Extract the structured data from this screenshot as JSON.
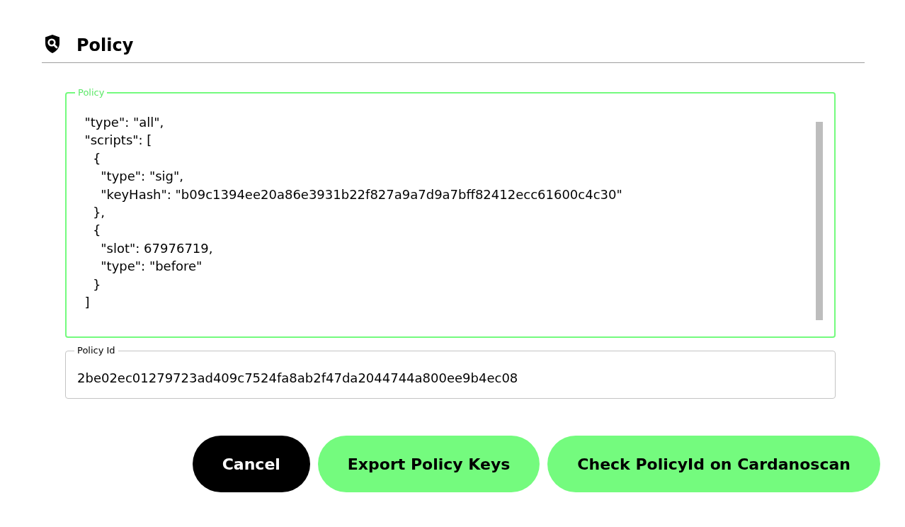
{
  "header": {
    "title": "Policy"
  },
  "policy_field": {
    "label": "Policy",
    "focused": true,
    "lines": [
      "  \"type\": \"all\",",
      "  \"scripts\": [",
      "    {",
      "      \"type\": \"sig\",",
      "      \"keyHash\": \"b09c1394ee20a86e3931b22f827a9a7d9a7bff82412ecc61600c4c30\"",
      "    },",
      "    {",
      "      \"slot\": 67976719,",
      "      \"type\": \"before\"",
      "    }",
      "  ]"
    ]
  },
  "policy_id_field": {
    "label": "Policy Id",
    "value": "2be02ec01279723ad409c7524fa8ab2f47da2044744a800ee9b4ec08"
  },
  "buttons": [
    {
      "label": "Cancel",
      "kind": "dark"
    },
    {
      "label": "Export Policy Keys",
      "kind": "green"
    },
    {
      "label": "Check PolicyId on Cardanoscan",
      "kind": "green"
    }
  ]
}
